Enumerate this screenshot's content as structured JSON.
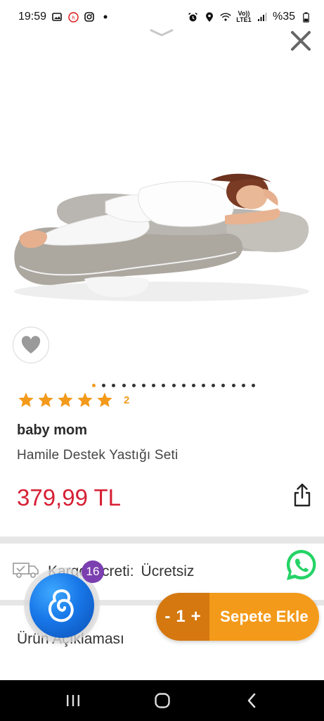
{
  "status_bar": {
    "time": "19:59",
    "battery": "%35",
    "network": "Vo)) LTE1",
    "left_icons": [
      "gallery-icon",
      "app-notification-icon",
      "instagram-icon",
      "dot-icon"
    ],
    "right_icons": [
      "alarm-icon",
      "location-icon",
      "wifi-icon",
      "lte-icon",
      "signal-icon",
      "battery-icon"
    ]
  },
  "product": {
    "rating_count": "2",
    "stars": 5,
    "brand": "baby mom",
    "name": "Hamile Destek Yastığı Seti",
    "price": "379,99 TL",
    "image_pager": {
      "total": 17,
      "active_index": 0
    }
  },
  "shipping": {
    "label": "Kargo Ücreti:",
    "value": "Ücretsiz"
  },
  "section": {
    "description_title": "Ürün Açıklaması"
  },
  "fab": {
    "badge_count": "16"
  },
  "cart": {
    "minus": "-",
    "quantity": "1",
    "plus": "+",
    "add_label": "Sepete Ekle"
  },
  "colors": {
    "accent": "#f39a1b",
    "accent_dark": "#d4780f",
    "price": "#d71f34",
    "whatsapp": "#25d366",
    "fab_blue": "#1877e8",
    "badge": "#7b3fb0"
  }
}
